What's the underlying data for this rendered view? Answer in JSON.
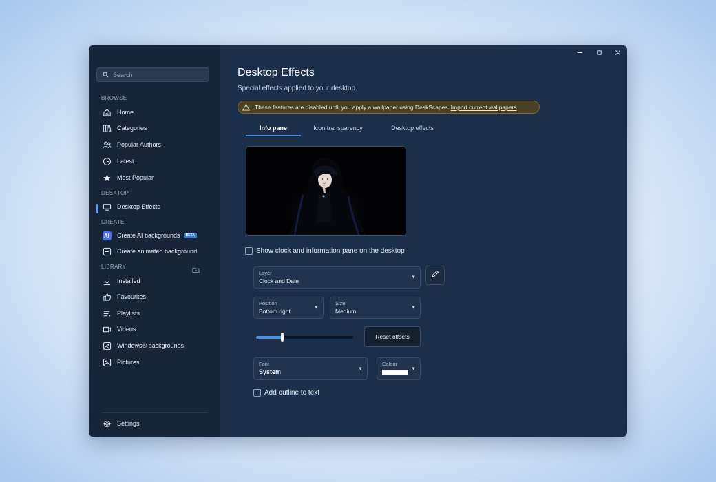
{
  "search": {
    "placeholder": "Search"
  },
  "sidebar": {
    "browse_label": "BROWSE",
    "browse_items": [
      {
        "label": "Home",
        "icon": "home-icon"
      },
      {
        "label": "Categories",
        "icon": "books-icon"
      },
      {
        "label": "Popular Authors",
        "icon": "people-icon"
      },
      {
        "label": "Latest",
        "icon": "clock-icon"
      },
      {
        "label": "Most Popular",
        "icon": "star-icon"
      }
    ],
    "desktop_label": "DESKTOP",
    "desktop_items": [
      {
        "label": "Desktop Effects",
        "icon": "monitor-icon"
      }
    ],
    "create_label": "CREATE",
    "create_items": [
      {
        "label": "Create AI backgrounds",
        "icon": "ai-icon",
        "badge": "BETA",
        "icon_text": "AI"
      },
      {
        "label": "Create animated background",
        "icon": "add-square-icon"
      }
    ],
    "library_label": "LIBRARY",
    "library_items": [
      {
        "label": "Installed",
        "icon": "download-icon"
      },
      {
        "label": "Favourites",
        "icon": "thumbs-up-icon"
      },
      {
        "label": "Playlists",
        "icon": "playlist-icon"
      },
      {
        "label": "Videos",
        "icon": "video-icon"
      },
      {
        "label": "Windows® backgrounds",
        "icon": "image-icon"
      },
      {
        "label": "Pictures",
        "icon": "picture-icon"
      }
    ],
    "settings_label": "Settings"
  },
  "page": {
    "title": "Desktop Effects",
    "subtitle": "Special effects applied to your desktop.",
    "warning_text": "These features are disabled until you apply a wallpaper using DeskScapes",
    "warning_link": "Import current wallpapers"
  },
  "tabs": [
    {
      "label": "Info pane",
      "active": true
    },
    {
      "label": "Icon transparency",
      "active": false
    },
    {
      "label": "Desktop effects",
      "active": false
    }
  ],
  "settings": {
    "show_clock_label": "Show clock and information pane on the desktop",
    "show_clock_checked": false,
    "layer": {
      "label": "Layer",
      "value": "Clock and Date"
    },
    "position": {
      "label": "Position",
      "value": "Bottom right"
    },
    "size": {
      "label": "Size",
      "value": "Medium"
    },
    "offset_slider_value": 0.27,
    "reset_label": "Reset offsets",
    "font": {
      "label": "Font",
      "value": "System"
    },
    "colour": {
      "label": "Colour",
      "value": "#ffffff"
    },
    "outline_label": "Add outline to text",
    "outline_checked": false
  },
  "colors": {
    "accent": "#4a90e2",
    "warning_bg": "#4a4226",
    "sidebar_bg": "#172539",
    "main_bg": "#1c2f4a"
  }
}
